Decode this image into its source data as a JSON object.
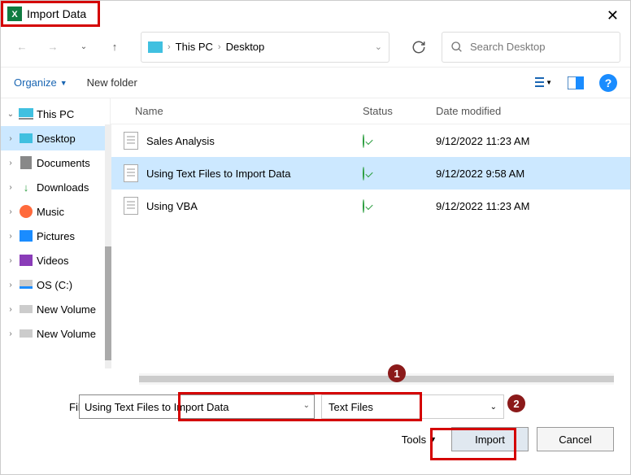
{
  "title": "Import Data",
  "breadcrumb": {
    "pc": "This PC",
    "folder": "Desktop"
  },
  "search_placeholder": "Search Desktop",
  "toolbar": {
    "organize": "Organize",
    "new_folder": "New folder",
    "help": "?"
  },
  "tree": {
    "root": "This PC",
    "items": [
      "Desktop",
      "Documents",
      "Downloads",
      "Music",
      "Pictures",
      "Videos",
      "OS (C:)",
      "New Volume",
      "New Volume"
    ]
  },
  "columns": {
    "name": "Name",
    "status": "Status",
    "date": "Date modified"
  },
  "files": [
    {
      "name": "Sales Analysis",
      "date": "9/12/2022 11:23 AM",
      "selected": false
    },
    {
      "name": "Using Text Files to Import Data",
      "date": "9/12/2022 9:58 AM",
      "selected": true
    },
    {
      "name": "Using VBA",
      "date": "9/12/2022 11:23 AM",
      "selected": false
    }
  ],
  "filename": {
    "label": "File name:",
    "value": "Using Text Files to Import Data"
  },
  "type_filter": "Text Files",
  "buttons": {
    "tools": "Tools",
    "import": "Import",
    "cancel": "Cancel"
  },
  "callouts": {
    "c1": "1",
    "c2": "2"
  }
}
